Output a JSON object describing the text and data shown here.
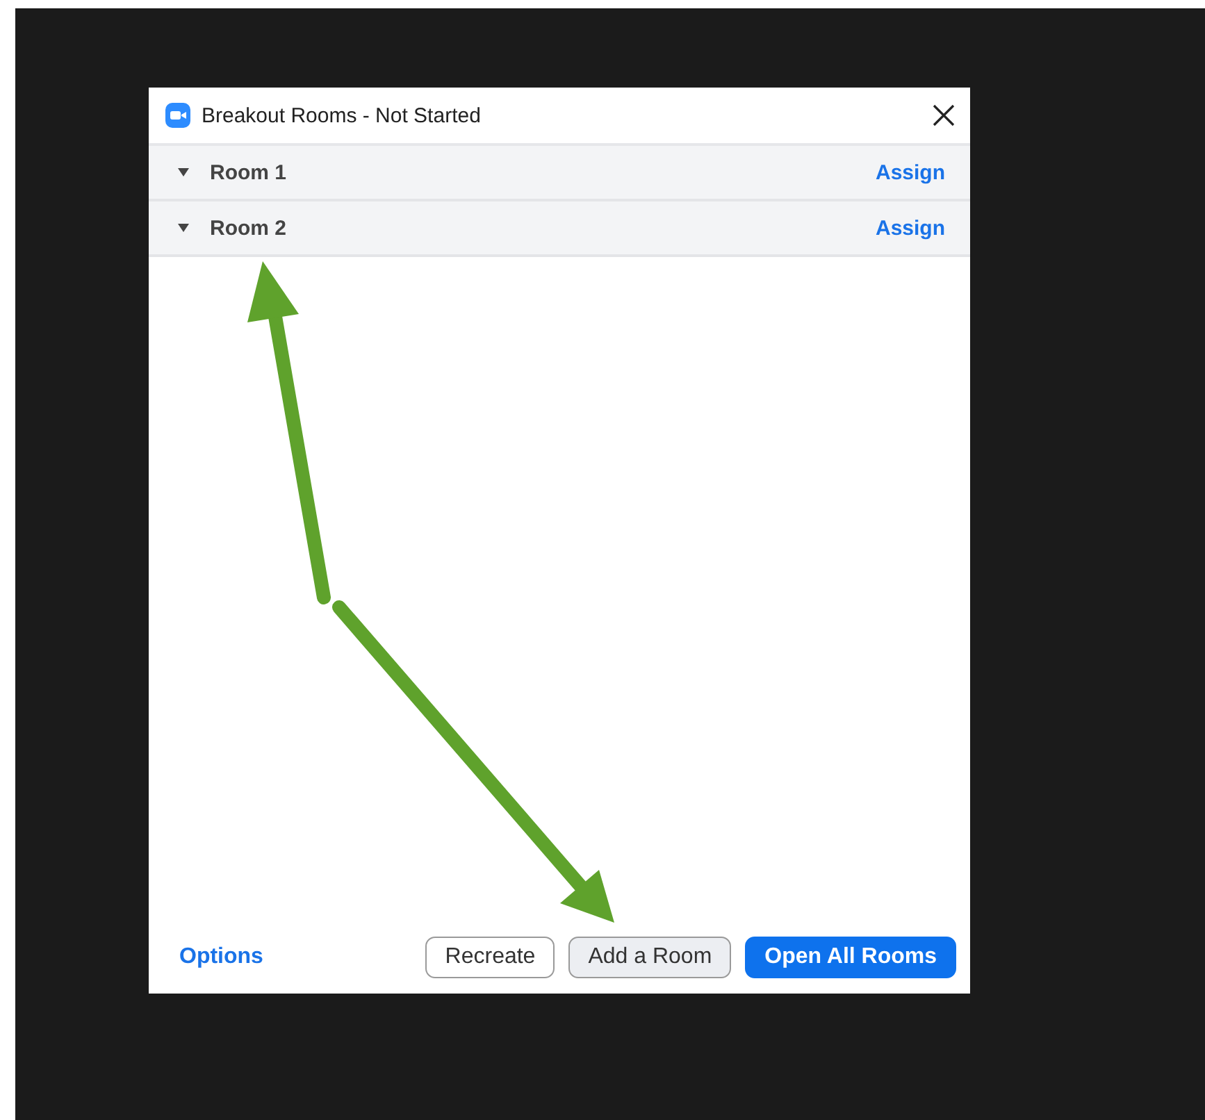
{
  "window": {
    "title": "Breakout Rooms - Not Started"
  },
  "rooms": [
    {
      "name": "Room 1",
      "expanded": true,
      "action": "Assign"
    },
    {
      "name": "Room 2",
      "expanded": true,
      "action": "Assign"
    }
  ],
  "footer": {
    "link": "Options",
    "buttons": [
      {
        "label": "Recreate",
        "kind": "secondary",
        "hovered": false
      },
      {
        "label": "Add a Room",
        "kind": "secondary",
        "hovered": true
      },
      {
        "label": "Open All Rooms",
        "kind": "primary",
        "hovered": false
      }
    ]
  }
}
